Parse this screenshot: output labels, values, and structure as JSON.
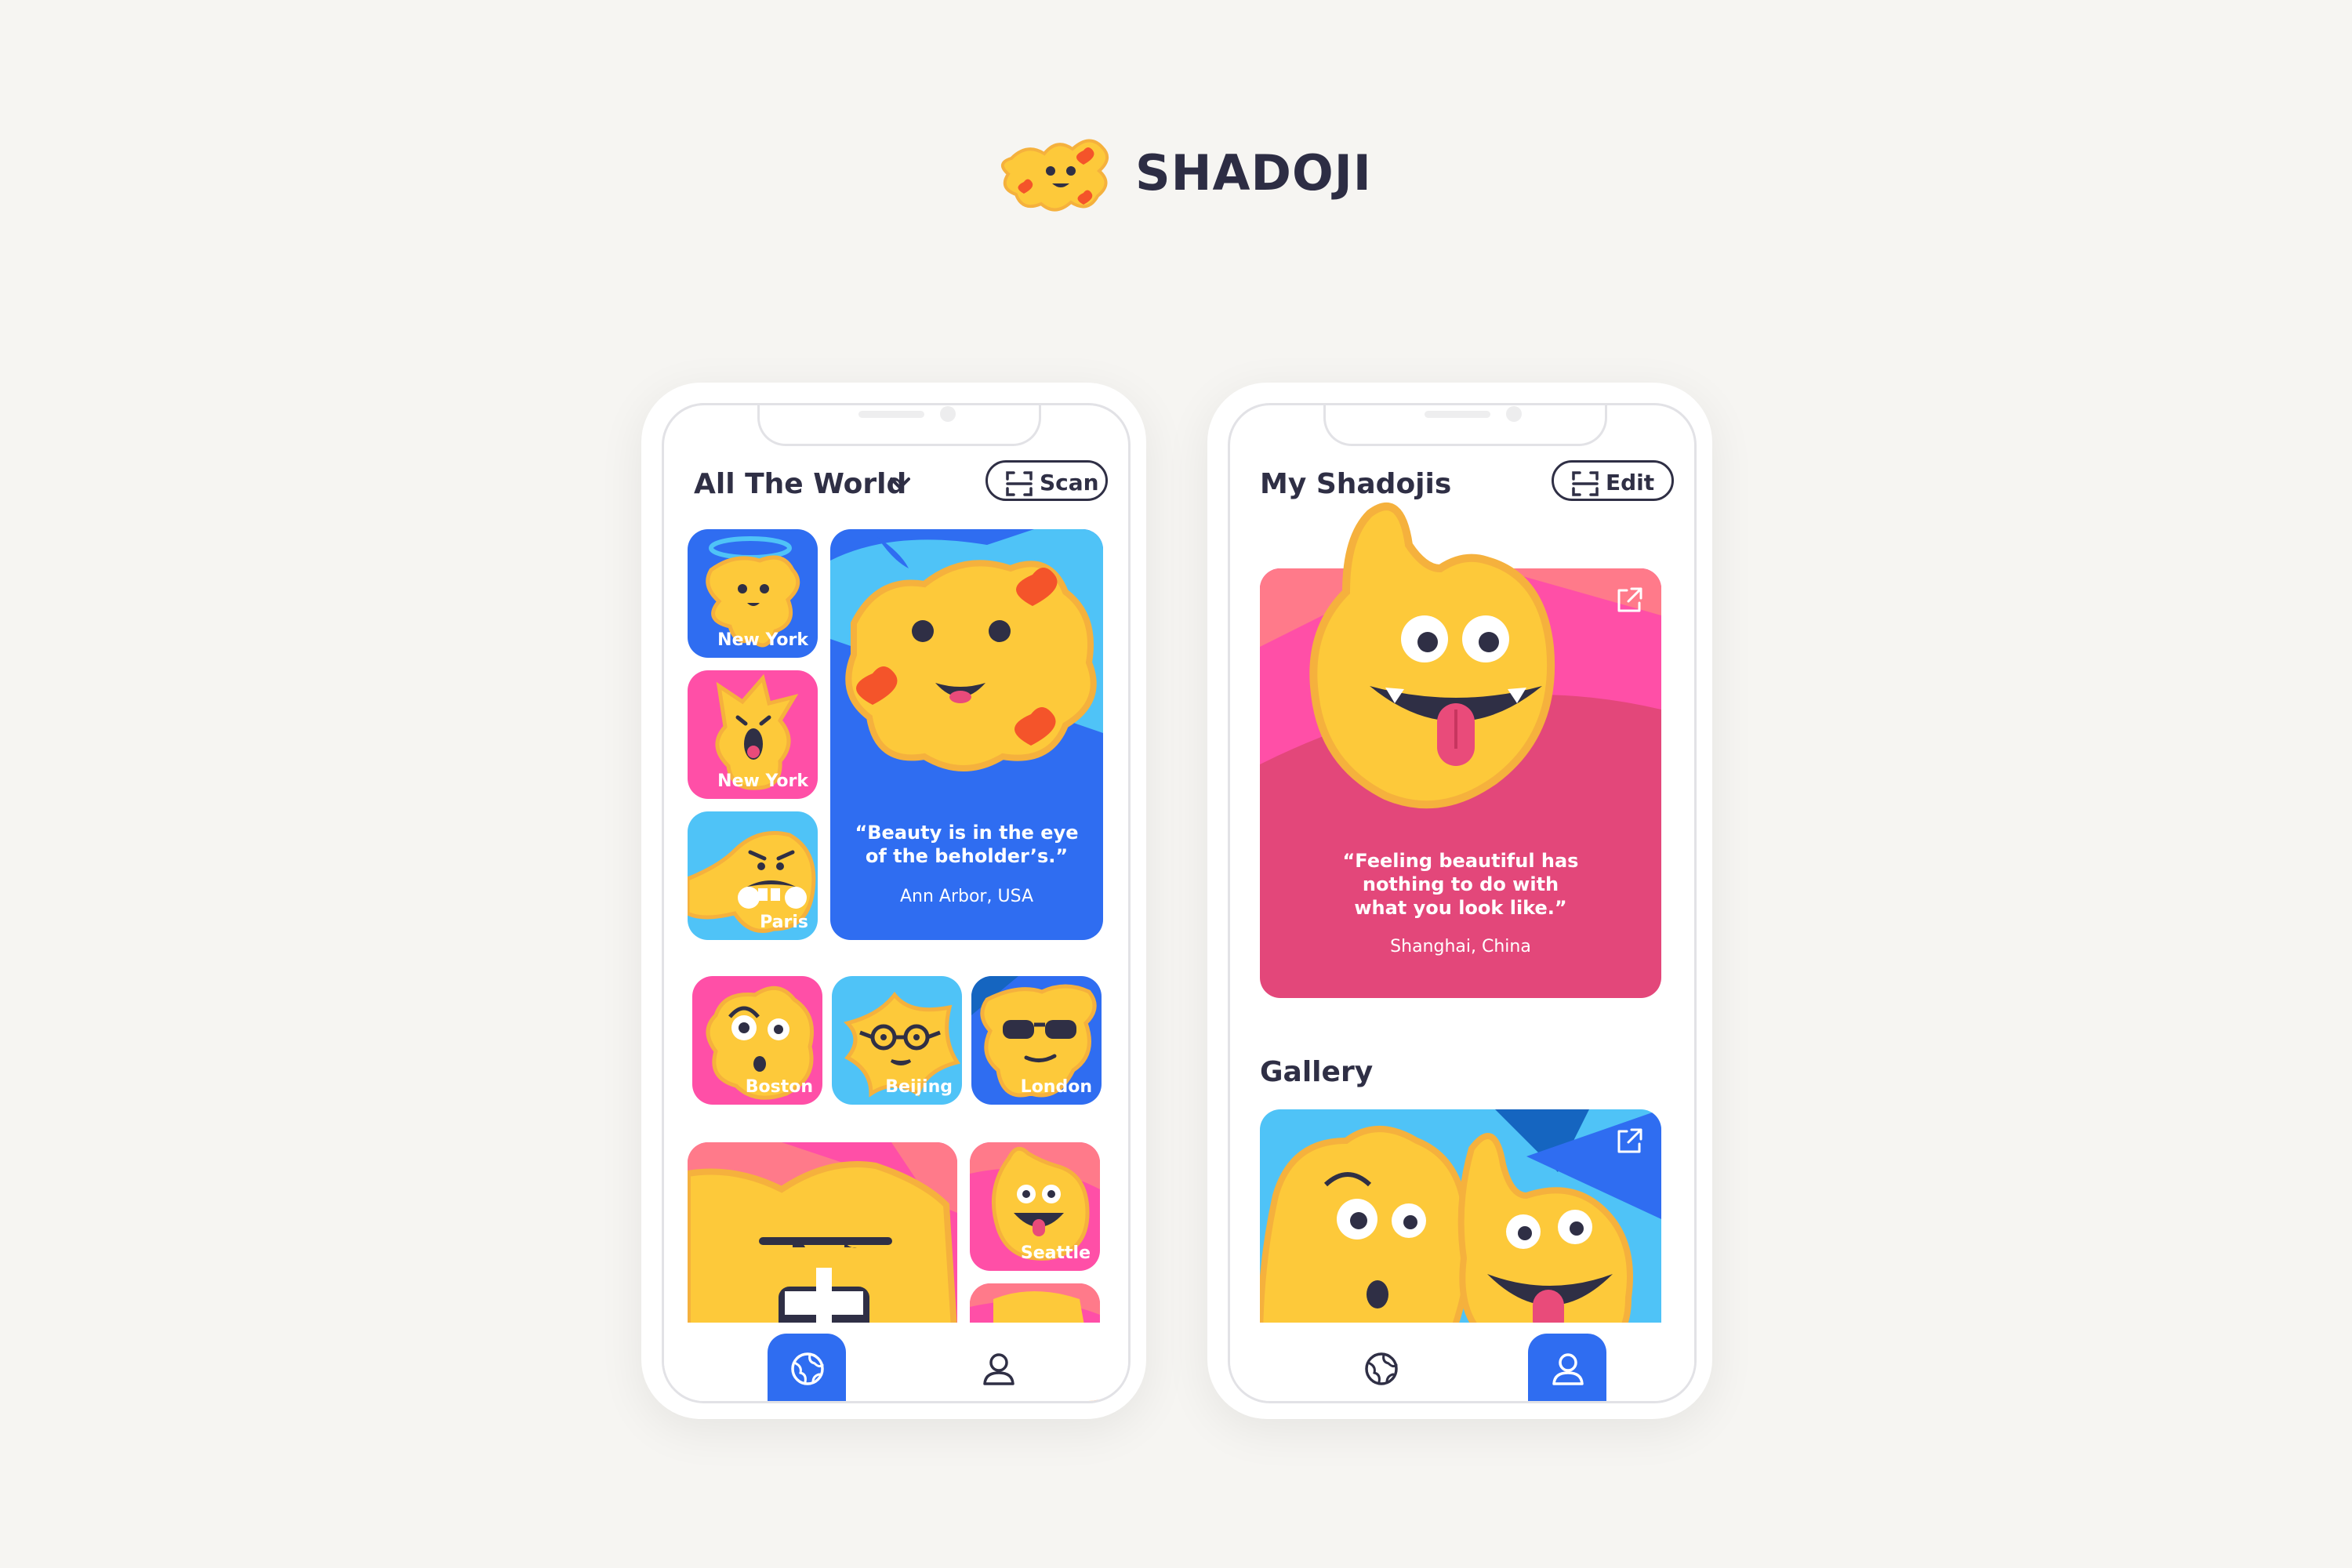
{
  "brand": {
    "name": "SHADOJI",
    "logo_icon": "shadoji-hearts-logo"
  },
  "colors": {
    "blue": "#2f6df1",
    "light_blue": "#4fc3f7",
    "pink": "#ff4fa7",
    "rose": "#e3477a",
    "yellow": "#fdc93a",
    "heart": "#f4542a",
    "dark": "#2f2f45"
  },
  "world_screen": {
    "title": "All The World",
    "dropdown_icon": "chevron-down-icon",
    "scan_button": {
      "label": "Scan",
      "icon": "scan-frame-icon"
    },
    "tiles": [
      {
        "location": "New York",
        "bg": "blue",
        "face": "angel-halo"
      },
      {
        "location": "New York",
        "bg": "pink",
        "face": "surprised"
      },
      {
        "location": "Paris",
        "bg": "light_blue",
        "face": "mustache"
      },
      {
        "location": "Boston",
        "bg": "pink",
        "face": "raised-brow"
      },
      {
        "location": "Beijing",
        "bg": "light_blue",
        "face": "glasses"
      },
      {
        "location": "London",
        "bg": "blue",
        "face": "sunglasses"
      },
      {
        "location": "Seattle",
        "bg": "pink",
        "face": "tongue-out"
      }
    ],
    "featured": {
      "quote": "“Beauty is in the eye of the beholder’s.”",
      "location": "Ann Arbor, USA"
    },
    "tabbar": {
      "world_icon": "globe-icon",
      "profile_icon": "user-icon",
      "active": "world"
    }
  },
  "my_screen": {
    "title": "My Shadojis",
    "edit_button": {
      "label": "Edit",
      "icon": "scan-frame-icon"
    },
    "featured": {
      "quote": "“Feeling beautiful has nothing to do with what you look like.”",
      "location": "Shanghai, China",
      "share_icon": "external-link-icon"
    },
    "gallery_title": "Gallery",
    "gallery_share_icon": "external-link-icon",
    "tabbar": {
      "world_icon": "globe-icon",
      "profile_icon": "user-icon",
      "active": "profile"
    }
  }
}
